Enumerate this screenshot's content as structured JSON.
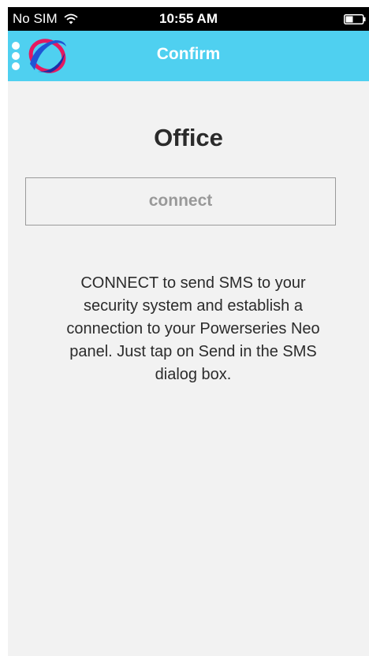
{
  "status_bar": {
    "carrier": "No SIM",
    "time": "10:55 AM",
    "wifi_icon": "wifi-icon",
    "battery_icon": "battery-icon"
  },
  "nav_bar": {
    "title": "Confirm",
    "background_color": "#4fd0f0",
    "logo_icon": "brand-logo-icon"
  },
  "main": {
    "title": "Office",
    "connect_button_label": "connect",
    "instructions": "CONNECT to send SMS to your security system and establish a connection to your Powerseries Neo panel. Just tap on Send in the SMS dialog box."
  }
}
